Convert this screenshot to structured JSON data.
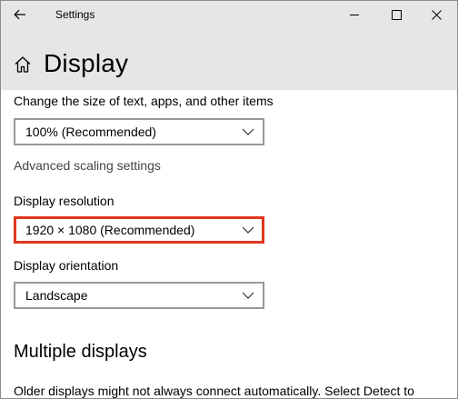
{
  "window": {
    "title": "Settings",
    "controls": [
      "minimize-icon",
      "maximize-icon",
      "close-icon"
    ],
    "back_icon": "back-arrow-icon"
  },
  "header": {
    "icon": "home-icon",
    "title": "Display"
  },
  "scale": {
    "label": "Change the size of text, apps, and other items",
    "selected": "100% (Recommended)",
    "advanced_link": "Advanced scaling settings"
  },
  "resolution": {
    "label": "Display resolution",
    "selected": "1920 × 1080 (Recommended)",
    "highlight_color": "#e0361f"
  },
  "orientation": {
    "label": "Display orientation",
    "selected": "Landscape"
  },
  "multiple": {
    "title": "Multiple displays",
    "description": "Older displays might not always connect automatically. Select Detect to"
  },
  "colors": {
    "titlebar_bg": "#e6e6e6",
    "dropdown_border": "#999999",
    "highlight": "#e0361f"
  }
}
